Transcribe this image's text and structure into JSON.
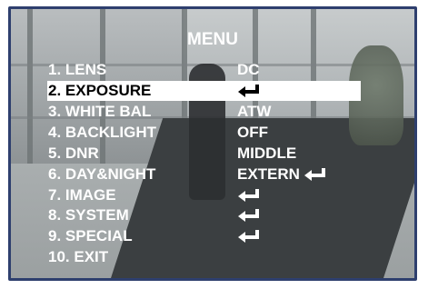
{
  "menu": {
    "title": "MENU",
    "items": [
      {
        "label": "1. LENS",
        "value": "DC",
        "enter": false
      },
      {
        "label": "2. EXPOSURE",
        "value": "",
        "enter": true
      },
      {
        "label": "3. WHITE BAL",
        "value": "ATW",
        "enter": false
      },
      {
        "label": "4. BACKLIGHT",
        "value": "OFF",
        "enter": false
      },
      {
        "label": "5. DNR",
        "value": "MIDDLE",
        "enter": false
      },
      {
        "label": "6. DAY&NIGHT",
        "value": "EXTERN",
        "enter": true
      },
      {
        "label": "7. IMAGE",
        "value": "",
        "enter": true
      },
      {
        "label": "8. SYSTEM",
        "value": "",
        "enter": true
      },
      {
        "label": "9. SPECIAL",
        "value": "",
        "enter": true
      },
      {
        "label": "10. EXIT",
        "value": "",
        "enter": false
      }
    ]
  },
  "colors": {
    "text": "#ffffff",
    "highlight": "#ffffff",
    "highlight_text": "#000000",
    "frame_border": "#2e3f6e"
  },
  "icons": {
    "enter": "enter-arrow-icon"
  }
}
